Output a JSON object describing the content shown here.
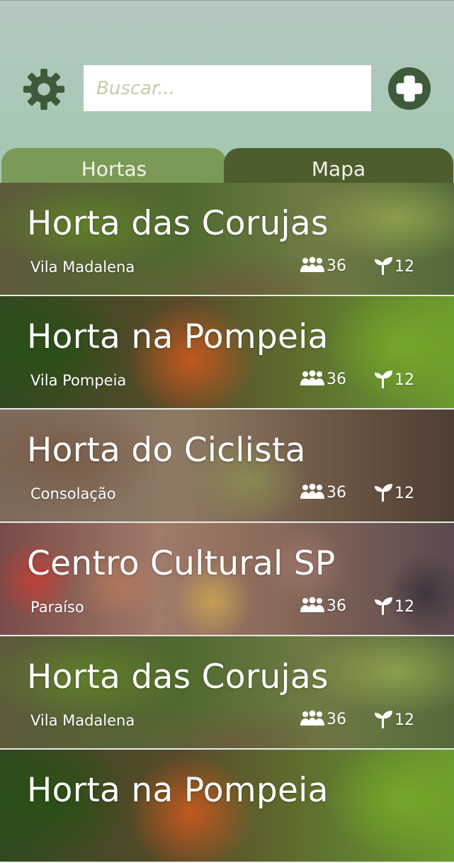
{
  "search": {
    "placeholder": "Buscar..."
  },
  "tabs": [
    {
      "label": "Hortas",
      "active": true
    },
    {
      "label": "Mapa",
      "active": false
    }
  ],
  "colors": {
    "header_bg": "#aac8b7",
    "icon_dark": "#3f5a3a",
    "tab_active": "#7b9a58",
    "tab_inactive": "#4e5d2d"
  },
  "icons": {
    "settings": "gear-icon",
    "add": "plus-circle-icon",
    "members": "people-icon",
    "plants": "sprout-icon"
  },
  "gardens": [
    {
      "name": "Horta das Corujas",
      "location": "Vila Madalena",
      "members": "36",
      "plants": "12"
    },
    {
      "name": "Horta na Pompeia",
      "location": "Vila Pompeia",
      "members": "36",
      "plants": "12"
    },
    {
      "name": "Horta do Ciclista",
      "location": "Consolação",
      "members": "36",
      "plants": "12"
    },
    {
      "name": "Centro Cultural SP",
      "location": "Paraíso",
      "members": "36",
      "plants": "12"
    },
    {
      "name": "Horta das Corujas",
      "location": "Vila Madalena",
      "members": "36",
      "plants": "12"
    },
    {
      "name": "Horta na Pompeia",
      "location": "",
      "members": "",
      "plants": ""
    }
  ]
}
